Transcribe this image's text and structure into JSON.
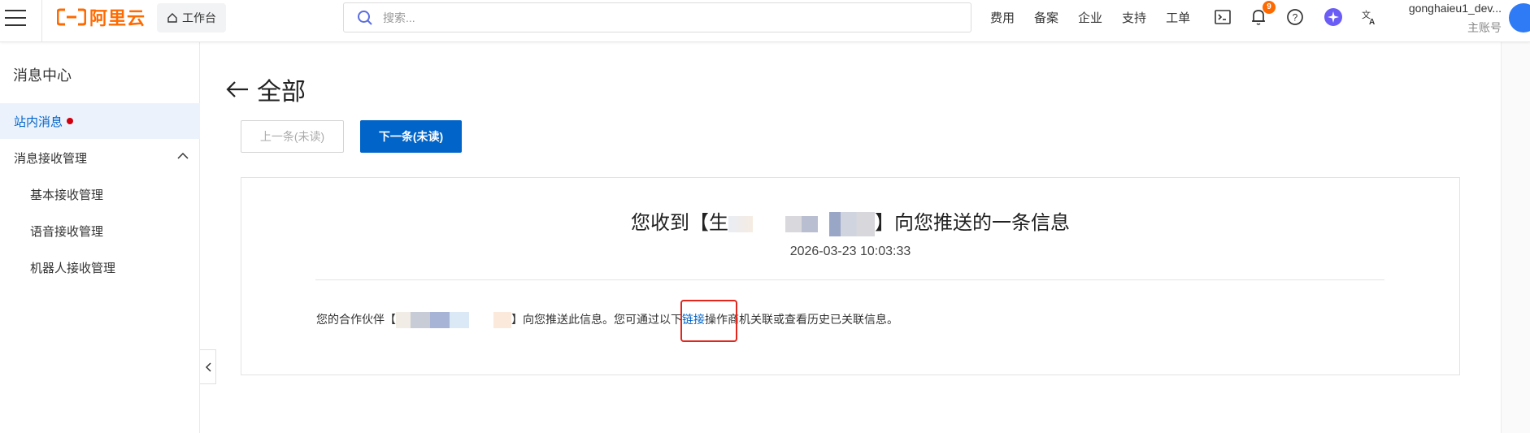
{
  "topbar": {
    "logo_text": "阿里云",
    "workbench_label": "工作台",
    "search_placeholder": "搜索...",
    "nav_links": [
      "费用",
      "备案",
      "企业",
      "支持",
      "工单"
    ],
    "notification_count": "9",
    "account_name": "gonghaieu1_dev...",
    "account_role": "主账号",
    "brand_color": "#ff6a00"
  },
  "sidebar": {
    "title": "消息中心",
    "items": [
      {
        "label": "站内消息"
      },
      {
        "label": "消息接收管理"
      },
      {
        "label": "基本接收管理"
      },
      {
        "label": "语音接收管理"
      },
      {
        "label": "机器人接收管理"
      }
    ],
    "active_color": "#0064c8"
  },
  "main": {
    "title": "全部",
    "prev_button": "上一条(未读)",
    "next_button": "下一条(未读)",
    "message": {
      "title_prefix": "您收到【生",
      "title_suffix": "】向您推送的一条信息",
      "time": "2026-03-23 10:03:33",
      "body_prefix": "您的合作伙伴【",
      "body_mid": "】向您推送此信息。您可通过以下",
      "link_text": "链接",
      "body_suffix": "操作商机关联或查看历史已关联信息。"
    }
  },
  "colors": {
    "primary": "#0064c8",
    "highlight_box": "#e0261d",
    "unread_dot": "#d1000e"
  }
}
